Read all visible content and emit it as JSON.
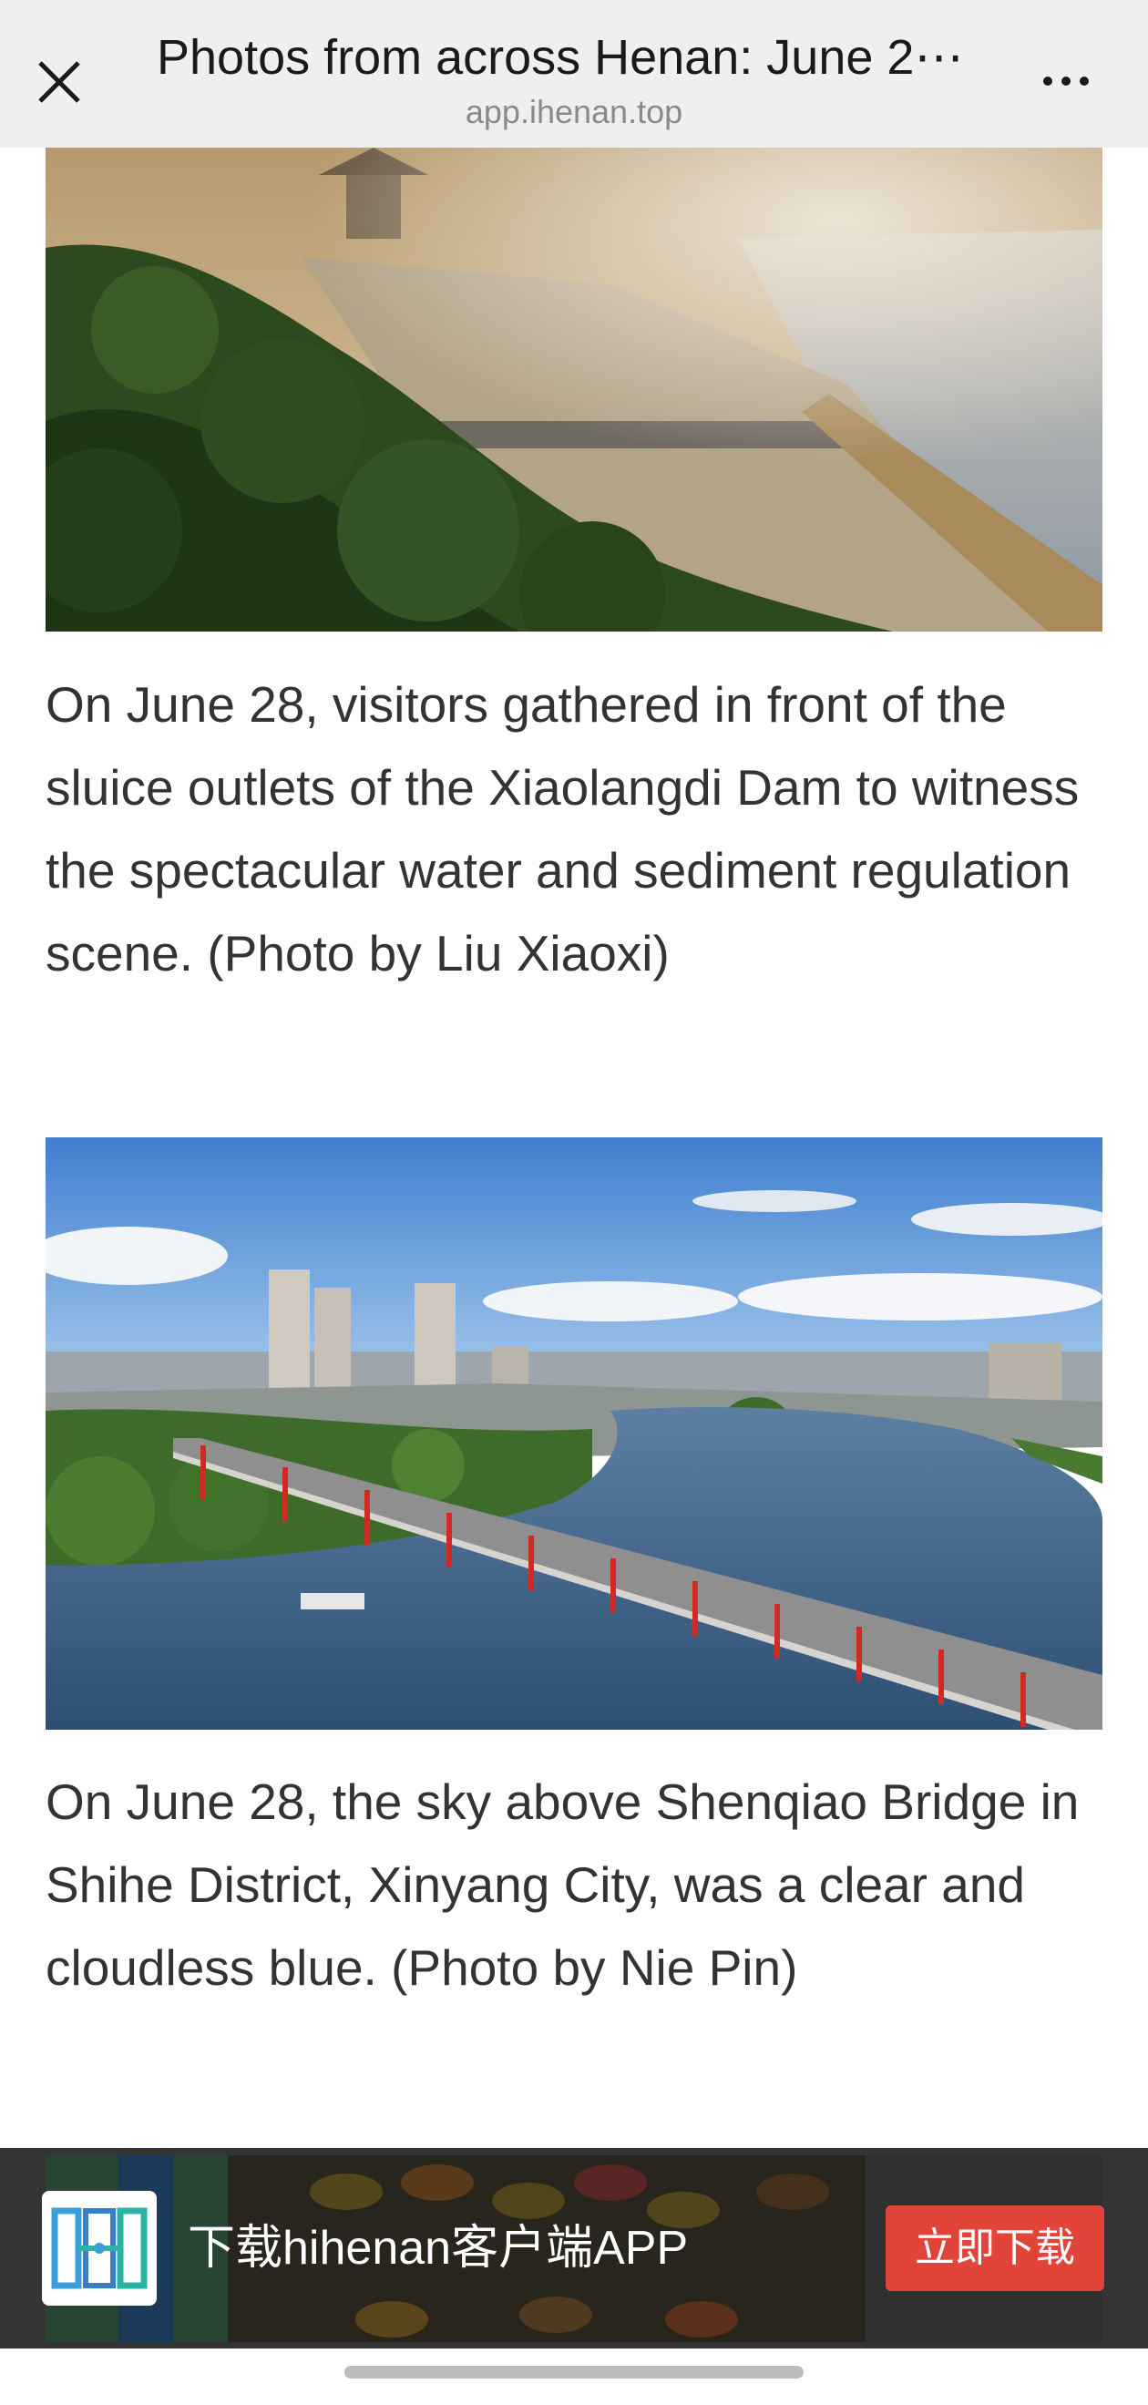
{
  "topbar": {
    "title": "Photos from across Henan: June 2⋯",
    "domain": "app.ihenan.top",
    "close_icon": "close-icon",
    "more_icon": "more-horizontal-icon"
  },
  "article": {
    "items": [
      {
        "caption": "On June 28, visitors gathered in front of the sluice outlets of the Xiaolangdi Dam to witness the spectacular water and sediment regulation scene. (Photo by Liu Xiaoxi)"
      },
      {
        "caption": "On June 28, the sky above Shenqiao Bridge in Shihe District, Xinyang City, was a clear and cloudless blue. (Photo by Nie Pin)"
      }
    ]
  },
  "banner": {
    "text": "下载hihenan客户端APP",
    "button_label": "立即下载",
    "button_color": "#e2443a"
  }
}
